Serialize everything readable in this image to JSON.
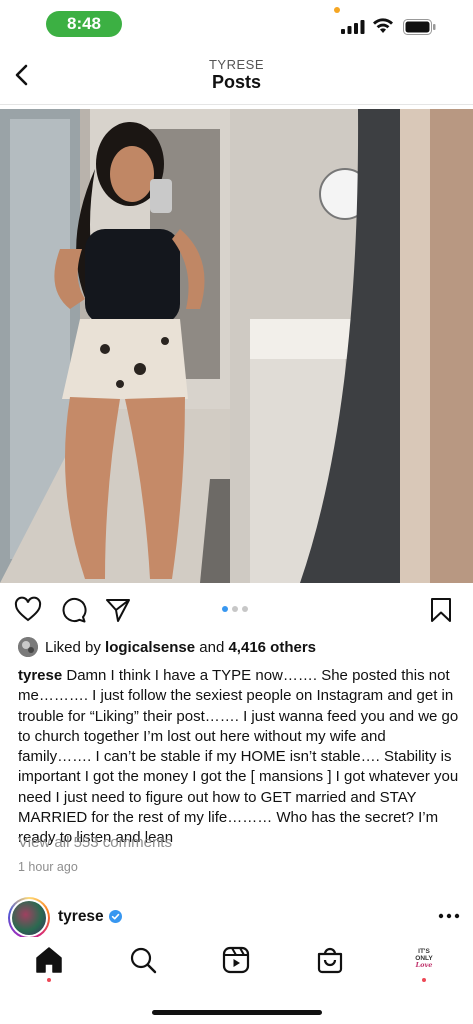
{
  "status_bar": {
    "time": "8:48",
    "time_pill_color": "#3cb043",
    "icons": [
      "signal-icon",
      "wifi-icon",
      "battery-icon"
    ]
  },
  "header": {
    "username": "TYRESE",
    "title": "Posts",
    "back_icon": "chevron-left-icon"
  },
  "post": {
    "image_description_icon": "photo",
    "carousel": {
      "total": 3,
      "active_index": 0
    },
    "actions": [
      "heart-icon",
      "comment-icon",
      "share-icon",
      "bookmark-icon"
    ],
    "likes": {
      "prefix": "Liked by",
      "user": "logicalsense",
      "conjunction": "and",
      "others": "4,416 others"
    },
    "caption": {
      "user": "tyrese",
      "text": "Damn I think I have a TYPE now……. She posted this not me………. I just follow the sexiest people on Instagram and get in trouble for “Liking” their post……. I just wanna feed you and we go to church together I’m lost out here without my wife and family……. I can’t be stable if my HOME isn’t stable…. Stability is important I got the money I got the [ mansions ] I got whatever you need I just need to figure out how to GET married and STAY MARRIED for the rest of my life……… Who has the secret? I’m ready to listen and lean"
    },
    "view_comments": "View all 553 comments",
    "time_ago": "1 hour ago"
  },
  "next_post": {
    "username": "tyrese",
    "verified": true,
    "more_icon": "more-horizontal-icon"
  },
  "bottom_nav": {
    "items": [
      "home-icon",
      "search-icon",
      "reels-icon",
      "shop-icon",
      "profile-avatar"
    ],
    "profile_text_line1": "IT'S ONLY",
    "profile_text_line2": "Love",
    "notification_color": "#ed4956"
  },
  "colors": {
    "accent_blue": "#3897f0",
    "muted_text": "#8e8e8e"
  }
}
